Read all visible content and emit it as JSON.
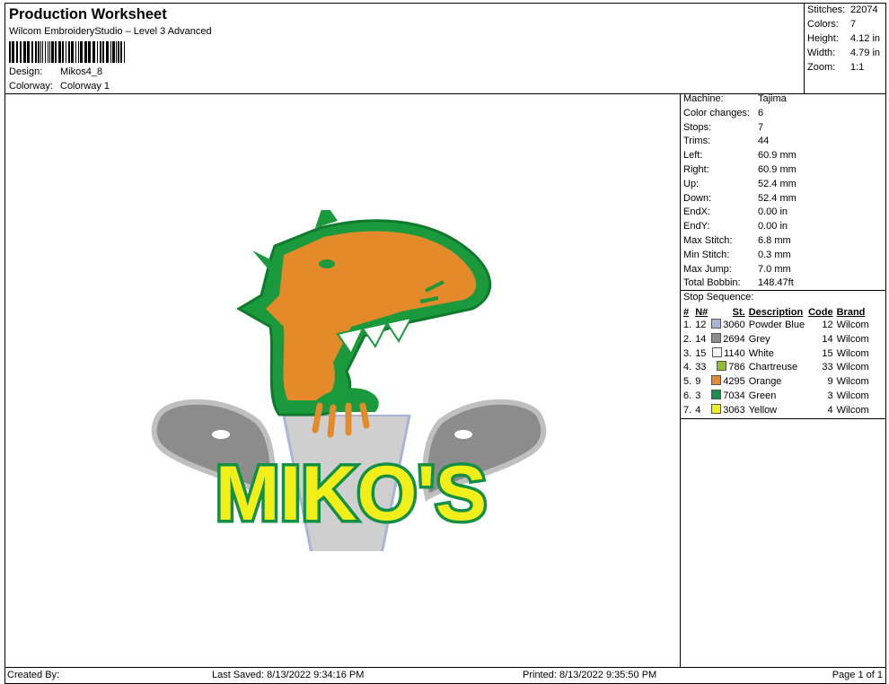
{
  "header": {
    "title": "Production Worksheet",
    "subtitle": "Wilcom EmbroideryStudio – Level 3 Advanced",
    "design_label": "Design:",
    "design_value": "Mikos4_8",
    "colorway_label": "Colorway:",
    "colorway_value": "Colorway 1"
  },
  "summary": [
    {
      "label": "Stitches:",
      "value": "22074"
    },
    {
      "label": "Colors:",
      "value": "7"
    },
    {
      "label": "Height:",
      "value": "4.12 in"
    },
    {
      "label": "Width:",
      "value": "4.79 in"
    },
    {
      "label": "Zoom:",
      "value": "1:1"
    }
  ],
  "details": [
    {
      "label": "Machine:",
      "value": "Tajima"
    },
    {
      "label": "Color changes:",
      "value": "6"
    },
    {
      "label": "Stops:",
      "value": "7"
    },
    {
      "label": "Trims:",
      "value": "44"
    },
    {
      "label": "Left:",
      "value": "60.9 mm"
    },
    {
      "label": "Right:",
      "value": "60.9 mm"
    },
    {
      "label": "Up:",
      "value": "52.4 mm"
    },
    {
      "label": "Down:",
      "value": "52.4 mm"
    },
    {
      "label": "EndX:",
      "value": "0.00 in"
    },
    {
      "label": "EndY:",
      "value": "0.00 in"
    },
    {
      "label": "Max Stitch:",
      "value": "6.8 mm"
    },
    {
      "label": "Min Stitch:",
      "value": "0.3 mm"
    },
    {
      "label": "Max Jump:",
      "value": "7.0 mm"
    },
    {
      "label": "Total Bobbin:",
      "value": "148.47ft"
    }
  ],
  "stop_sequence": {
    "title": "Stop Sequence:",
    "headers": [
      "#",
      "N#",
      "St.",
      "Description",
      "Code",
      "Brand"
    ],
    "rows": [
      {
        "num": "1.",
        "n": "12",
        "color": "#a9b4d6",
        "st": "3060",
        "desc": "Powder Blue",
        "code": "12",
        "brand": "Wilcom"
      },
      {
        "num": "2.",
        "n": "14",
        "color": "#8c8c8c",
        "st": "2694",
        "desc": "Grey",
        "code": "14",
        "brand": "Wilcom"
      },
      {
        "num": "3.",
        "n": "15",
        "color": "#ffffff",
        "st": "1140",
        "desc": "White",
        "code": "15",
        "brand": "Wilcom"
      },
      {
        "num": "4.",
        "n": "33",
        "color": "#8dbf2e",
        "st": "786",
        "desc": "Chartreuse",
        "code": "33",
        "brand": "Wilcom"
      },
      {
        "num": "5.",
        "n": "9",
        "color": "#e58a2a",
        "st": "4295",
        "desc": "Orange",
        "code": "9",
        "brand": "Wilcom"
      },
      {
        "num": "6.",
        "n": "3",
        "color": "#129046",
        "st": "7034",
        "desc": "Green",
        "code": "3",
        "brand": "Wilcom"
      },
      {
        "num": "7.",
        "n": "4",
        "color": "#f2ee1a",
        "st": "3063",
        "desc": "Yellow",
        "code": "4",
        "brand": "Wilcom"
      }
    ]
  },
  "design_text": "MIKO'S",
  "footer": {
    "created": "Created By:",
    "saved": "Last Saved: 8/13/2022 9:34:16 PM",
    "printed": "Printed: 8/13/2022 9:35:50 PM",
    "page": "Page 1 of 1"
  }
}
